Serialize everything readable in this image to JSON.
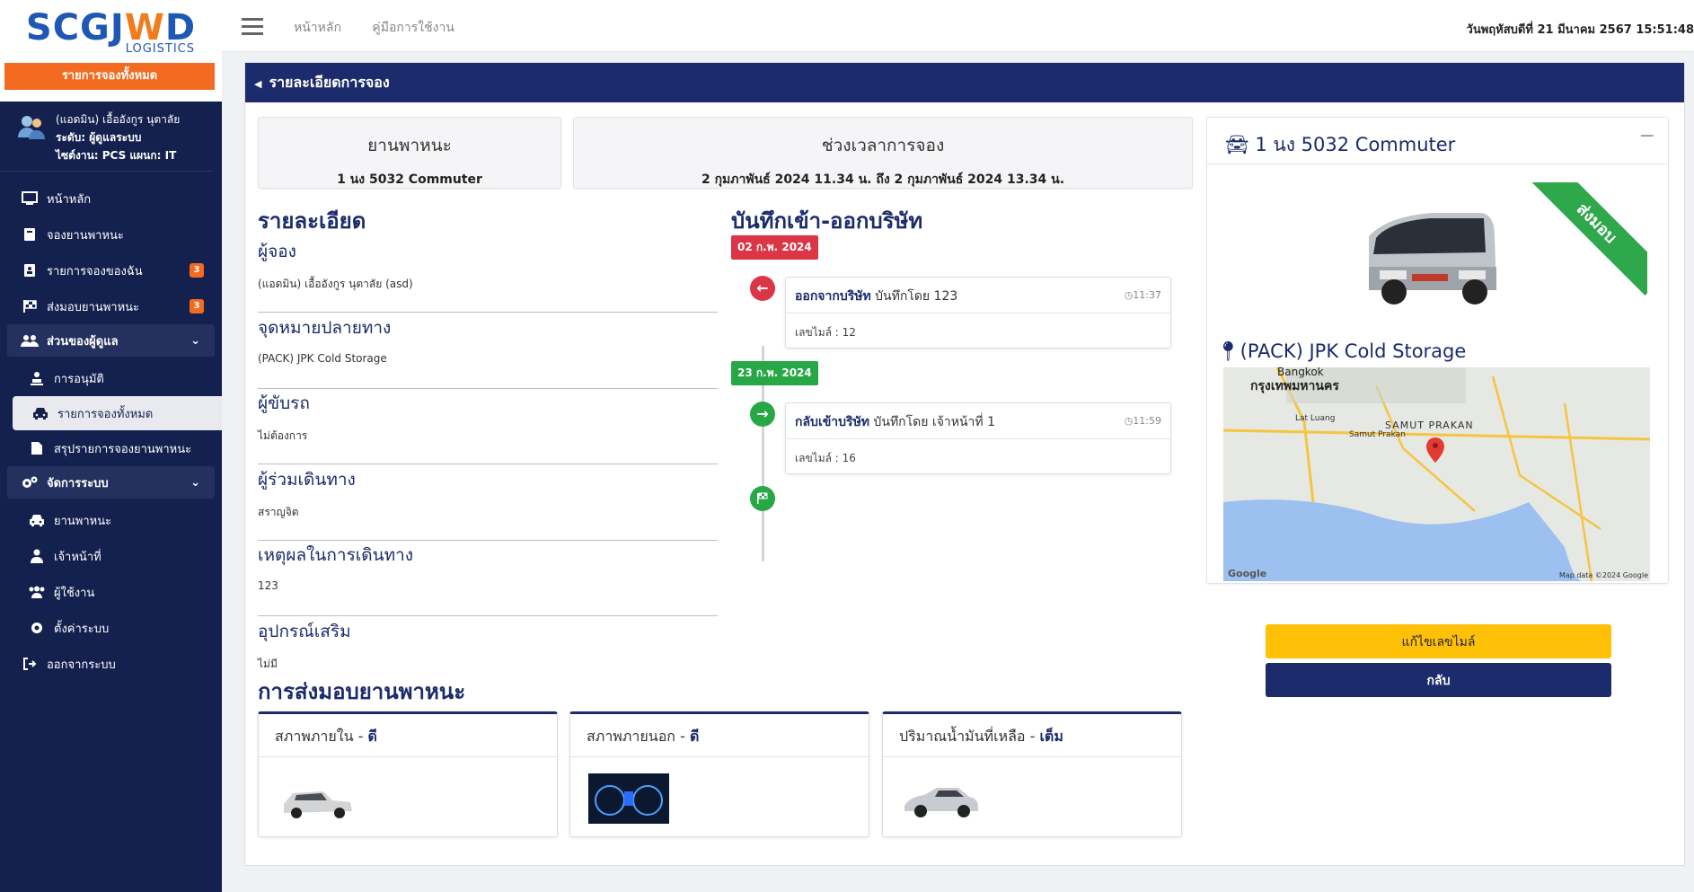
{
  "brand": {
    "logo_text_a": "SCG",
    "logo_text_b": "J",
    "logo_text_o": "W",
    "logo_text_c": "D",
    "logo_sub": "LOGISTICS",
    "header_button": "รายการจองทั้งหมด"
  },
  "user": {
    "name": "(แอดมิน) เอื้ออังกูร นุตาลัย",
    "level": "ระดับ: ผู้ดูแลระบบ",
    "site": "ไซต์งาน: PCS แผนก: IT"
  },
  "nav": {
    "home": "หน้าหลัก",
    "book": "จองยานพาหนะ",
    "my_bookings": "รายการจองของฉัน",
    "my_bookings_badge": "3",
    "handover": "ส่งมอบยานพาหนะ",
    "handover_badge": "3",
    "admin_group": "ส่วนของผู้ดูแล",
    "approve": "การอนุมัติ",
    "all_bookings": "รายการจองทั้งหมด",
    "summary": "สรุปรายการจองยานพาหนะ",
    "system_group": "จัดการระบบ",
    "vehicles": "ยานพาหนะ",
    "staff": "เจ้าหน้าที่",
    "users": "ผู้ใช้งาน",
    "settings": "ตั้งค่าระบบ",
    "logout": "ออกจากระบบ"
  },
  "topbar": {
    "link_home": "หน้าหลัก",
    "link_manual": "คู่มือการใช้งาน",
    "datetime": "วันพฤหัสบดีที่ 21 มีนาคม 2567  15:51:48"
  },
  "panel": {
    "title": "รายละเอียดการจอง"
  },
  "info": {
    "vehicle_label": "ยานพาหนะ",
    "vehicle_value": "1 นง 5032 Commuter",
    "period_label": "ช่วงเวลาการจอง",
    "period_value": "2 กุมภาพันธ์ 2024 11.34 น. ถึง 2 กุมภาพันธ์ 2024 13.34 น."
  },
  "details": {
    "title": "รายละเอียด",
    "booker_label": "ผู้จอง",
    "booker_value": "(แอดมิน) เอื้ออังกูร นุตาลัย (asd)",
    "destination_label": "จุดหมายปลายทาง",
    "destination_value": "(PACK) JPK Cold Storage",
    "driver_label": "ผู้ขับรถ",
    "driver_value": "ไม่ต้องการ",
    "companions_label": "ผู้ร่วมเดินทาง",
    "companions_value": "สราญจิต",
    "reason_label": "เหตุผลในการเดินทาง",
    "reason_value": "123",
    "equipment_label": "อุปกรณ์เสริม",
    "equipment_value": "ไม่มี"
  },
  "log": {
    "title": "บันทึกเข้า-ออกบริษัท",
    "date1": "02 ก.พ. 2024",
    "entry1_action": "ออกจากบริษัท",
    "entry1_by": " บันทึกโดย 123",
    "entry1_time": "11:37",
    "entry1_mile": "เลขไมล์ : 12",
    "date2": "23 ก.พ. 2024",
    "entry2_action": "กลับเข้าบริษัท",
    "entry2_by": " บันทึกโดย เจ้าหน้าที่ 1",
    "entry2_time": "11:59",
    "entry2_mile": "เลขไมล์ : 16"
  },
  "vehicle_card": {
    "title": "1 นง 5032 Commuter",
    "ribbon": "ส่งมอบ",
    "location": "(PACK) JPK Cold Storage",
    "map_labels": {
      "bangkok": "Bangkok",
      "bangkok_th": "กรุงเทพมหานคร",
      "samut": "SAMUT PRAKAN",
      "lat_luang": "Lat Luang",
      "samut_small": "Samut Prakan",
      "google": "Google",
      "credit": "Map data ©2024 Google"
    }
  },
  "buttons": {
    "edit_mile": "แก้ไขเลขไมล์",
    "back": "กลับ"
  },
  "handover": {
    "title": "การส่งมอบยานพาหนะ",
    "interior_label": "สภาพภายใน - ",
    "interior_value": "ดี",
    "exterior_label": "สภาพภายนอก - ",
    "exterior_value": "ดี",
    "fuel_label": "ปริมาณน้ำมันที่เหลือ - ",
    "fuel_value": "เต็ม"
  },
  "colors": {
    "navy": "#1b2b6b",
    "sidebar": "#14214f",
    "orange": "#f36b21",
    "red": "#dc3545",
    "green": "#28a745",
    "yellow": "#ffc107"
  }
}
